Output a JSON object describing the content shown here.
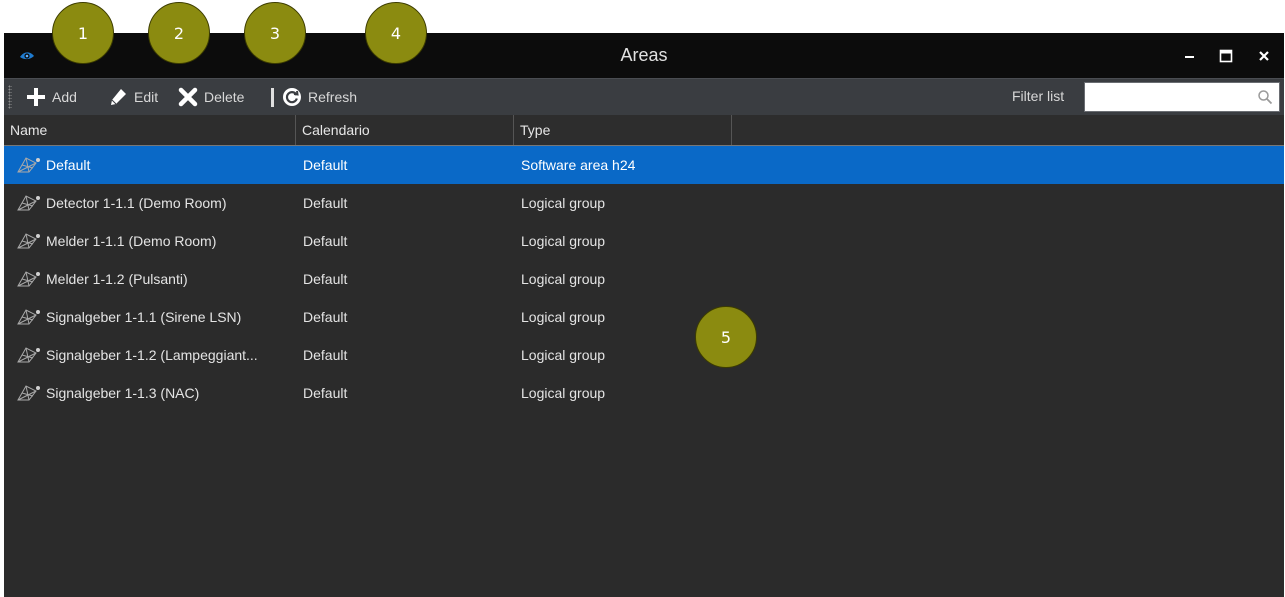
{
  "window": {
    "title": "Areas",
    "controls": {
      "minimize": "–",
      "maximize": "▢",
      "close": "✕"
    }
  },
  "toolbar": {
    "add_label": "Add",
    "edit_label": "Edit",
    "delete_label": "Delete",
    "refresh_label": "Refresh",
    "filter_label": "Filter list",
    "filter_value": "",
    "filter_placeholder": ""
  },
  "table": {
    "columns": [
      "Name",
      "Calendario",
      "Type"
    ],
    "rows": [
      {
        "name": "Default",
        "calendar": "Default",
        "type": "Software area h24",
        "selected": true
      },
      {
        "name": "Detector 1-1.1 (Demo Room)",
        "calendar": "Default",
        "type": "Logical group"
      },
      {
        "name": "Melder 1-1.1 (Demo Room)",
        "calendar": "Default",
        "type": "Logical group"
      },
      {
        "name": "Melder 1-1.2 (Pulsanti)",
        "calendar": "Default",
        "type": "Logical group"
      },
      {
        "name": "Signalgeber 1-1.1 (Sirene LSN)",
        "calendar": "Default",
        "type": "Logical group"
      },
      {
        "name": "Signalgeber 1-1.2 (Lampeggiant...",
        "calendar": "Default",
        "type": "Logical group"
      },
      {
        "name": "Signalgeber 1-1.3 (NAC)",
        "calendar": "Default",
        "type": "Logical group"
      }
    ]
  },
  "callouts": [
    "1",
    "2",
    "3",
    "4",
    "5"
  ],
  "icons": {
    "app": "eye-icon",
    "add": "plus-icon",
    "edit": "pencil-icon",
    "delete": "x-icon",
    "refresh": "refresh-icon",
    "search": "search-icon",
    "row": "network-group-icon"
  },
  "colors": {
    "titlebar": "#0c0c0c",
    "toolbar": "#3a3d41",
    "background": "#2b2b2b",
    "selection": "#0a69c7",
    "callout": "#8b8b10"
  }
}
